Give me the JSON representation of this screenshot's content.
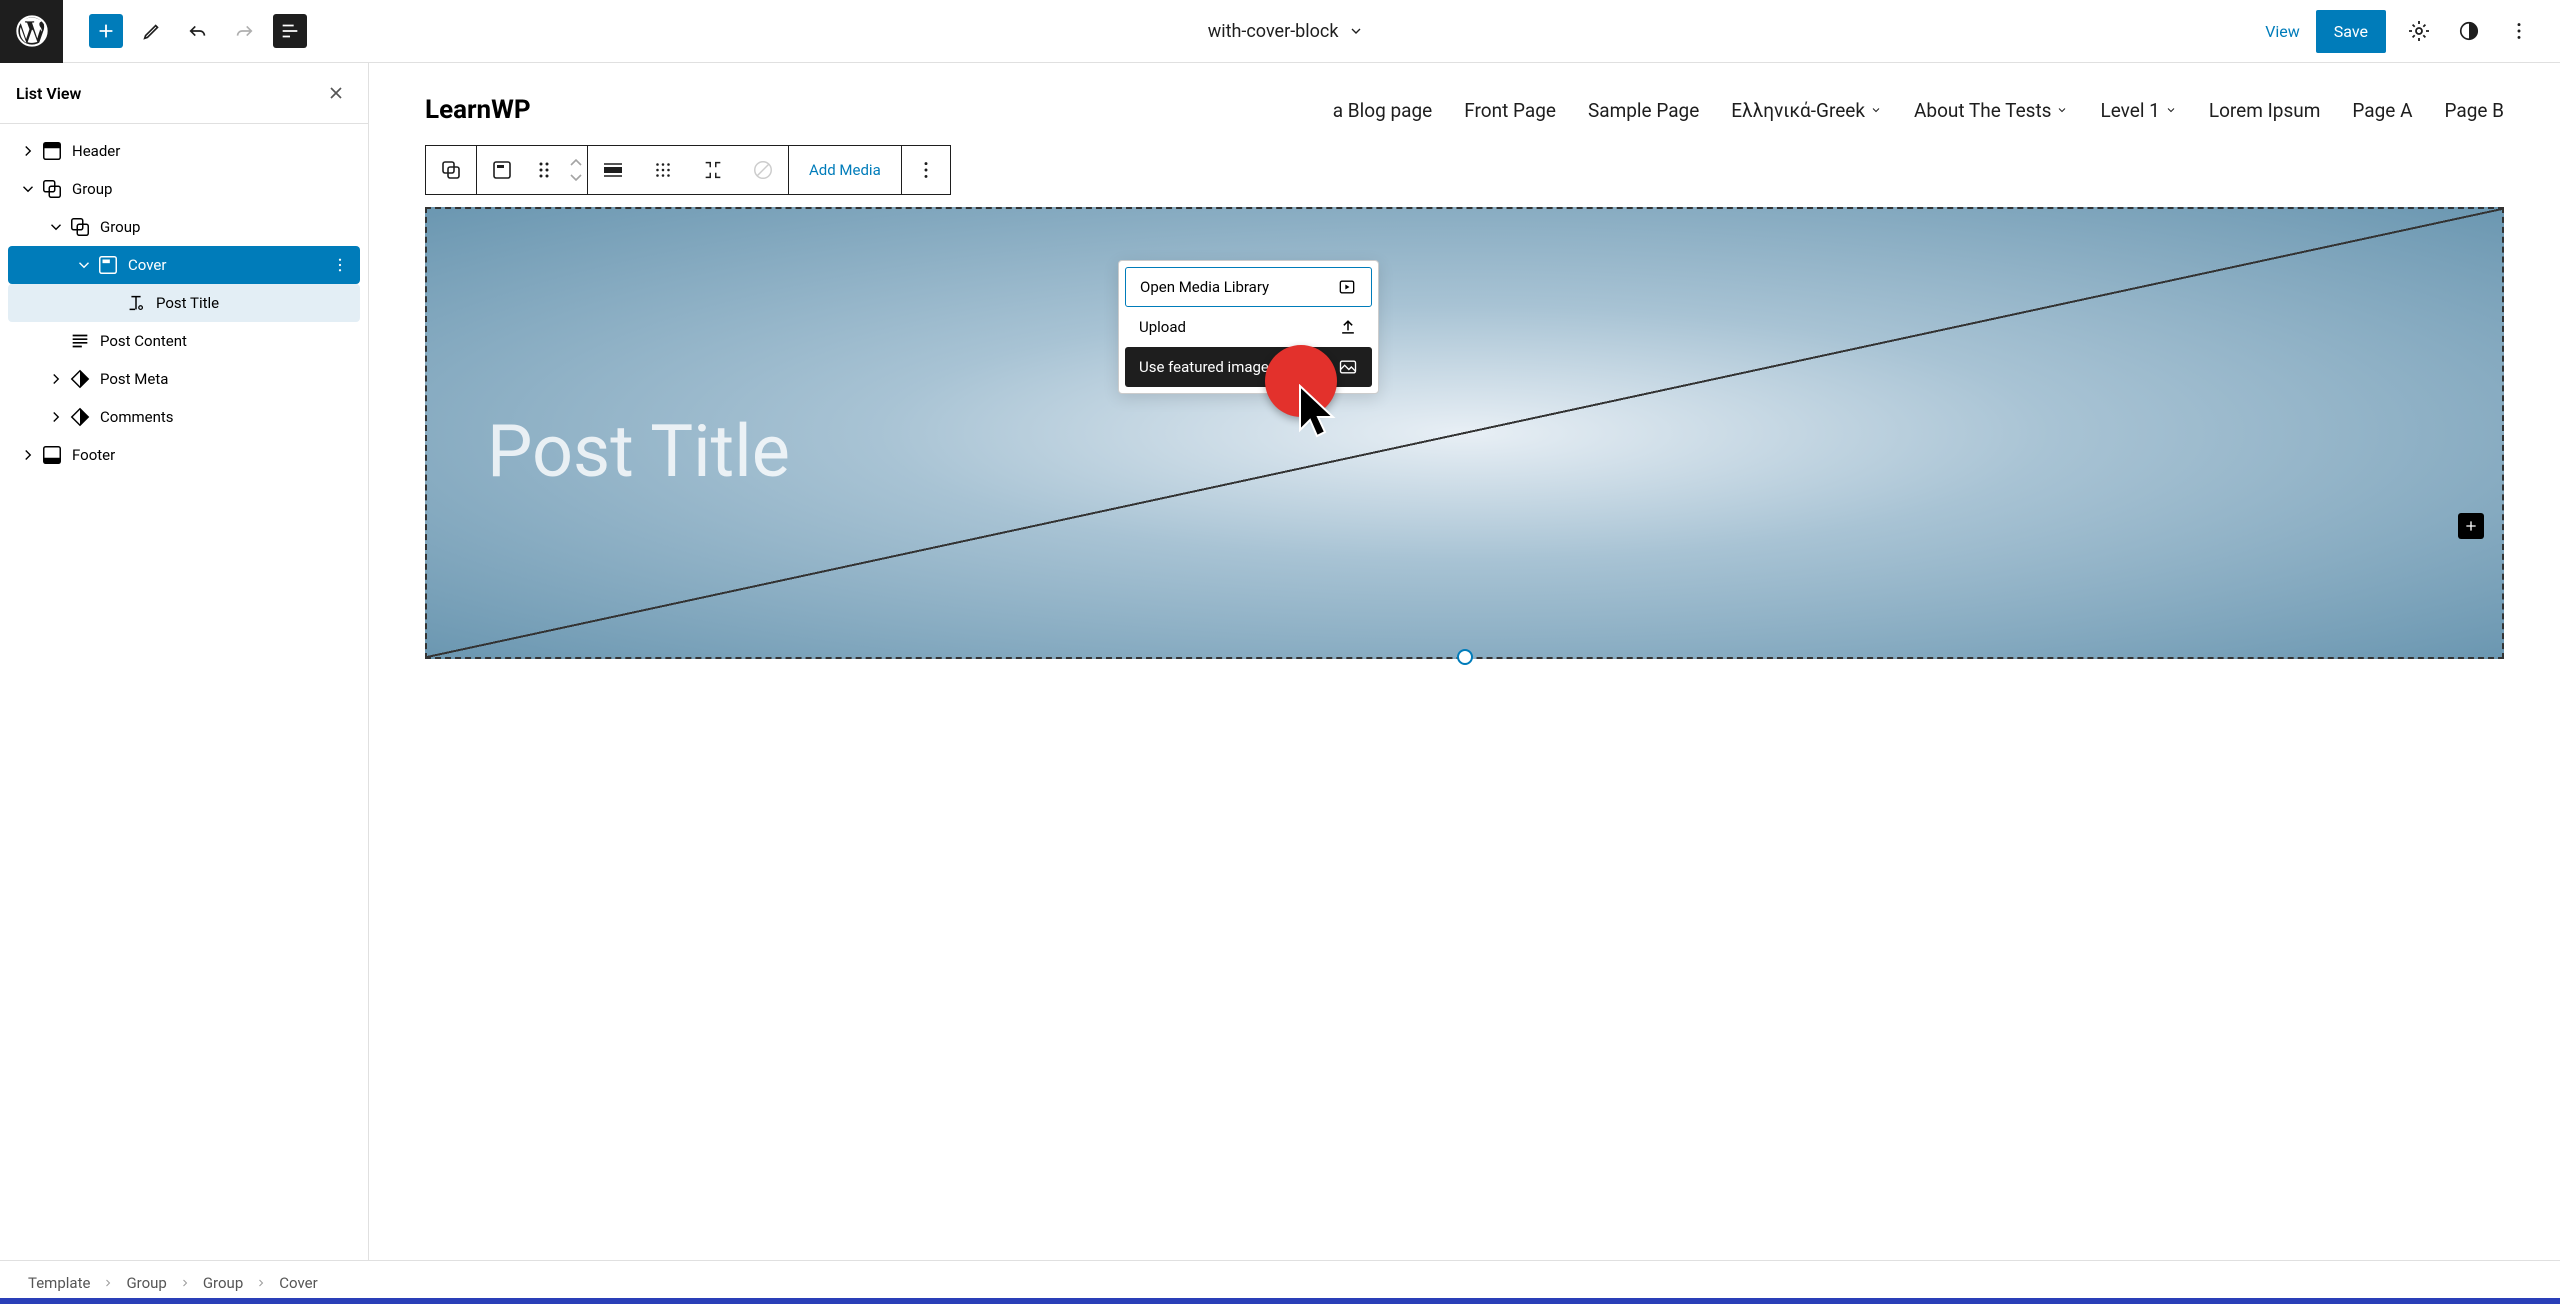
{
  "topbar": {
    "document_title": "with-cover-block",
    "view": "View",
    "save": "Save"
  },
  "sidebar": {
    "title": "List View",
    "items": [
      {
        "label": "Header",
        "indent": 0,
        "chev": "right",
        "icon": "header"
      },
      {
        "label": "Group",
        "indent": 0,
        "chev": "down",
        "icon": "group"
      },
      {
        "label": "Group",
        "indent": 1,
        "chev": "down",
        "icon": "group"
      },
      {
        "label": "Cover",
        "indent": 2,
        "chev": "down",
        "icon": "cover",
        "sel": true
      },
      {
        "label": "Post Title",
        "indent": 3,
        "chev": "",
        "icon": "title",
        "sub": true
      },
      {
        "label": "Post Content",
        "indent": 1,
        "chev": "",
        "icon": "content"
      },
      {
        "label": "Post Meta",
        "indent": 1,
        "chev": "right",
        "icon": "meta"
      },
      {
        "label": "Comments",
        "indent": 1,
        "chev": "right",
        "icon": "meta"
      },
      {
        "label": "Footer",
        "indent": 0,
        "chev": "right",
        "icon": "footer"
      }
    ]
  },
  "nav": {
    "site_title": "LearnWP",
    "items": [
      {
        "label": "a Blog page",
        "dd": false
      },
      {
        "label": "Front Page",
        "dd": false
      },
      {
        "label": "Sample Page",
        "dd": false
      },
      {
        "label": "Ελληνικά-Greek",
        "dd": true
      },
      {
        "label": "About The Tests",
        "dd": true
      },
      {
        "label": "Level 1",
        "dd": true
      },
      {
        "label": "Lorem Ipsum",
        "dd": false
      },
      {
        "label": "Page A",
        "dd": false
      },
      {
        "label": "Page B",
        "dd": false
      }
    ]
  },
  "block_toolbar": {
    "add_media": "Add Media"
  },
  "popover": {
    "items": [
      {
        "label": "Open Media Library",
        "icon": "media"
      },
      {
        "label": "Upload",
        "icon": "upload"
      },
      {
        "label": "Use featured image",
        "icon": "featured",
        "hov": true
      }
    ]
  },
  "cover": {
    "post_title": "Post Title"
  },
  "breadcrumb": {
    "parts": [
      "Template",
      "Group",
      "Group",
      "Cover"
    ]
  }
}
